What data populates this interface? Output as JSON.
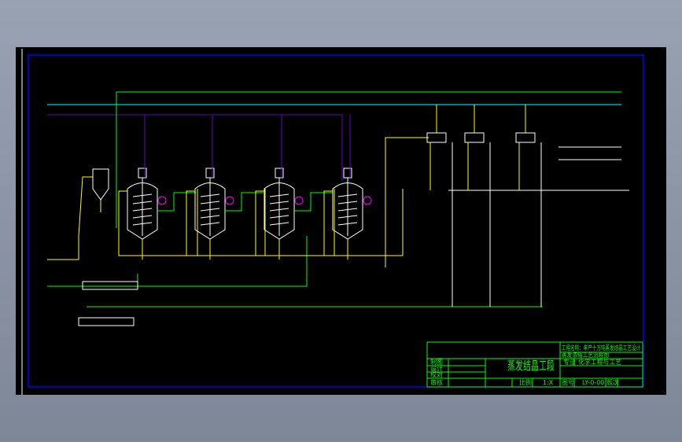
{
  "title_block": {
    "project_line1": "工程名称：年产十万吨蒸发结晶工艺设计",
    "project_line2": "蒸发浓缩工艺流程图",
    "drawing_title": "蒸发结晶工段",
    "major_label": "专业",
    "major_value": "化学工程与工艺",
    "rows": [
      "制图",
      "设计",
      "校对",
      "审核"
    ],
    "scale_label": "比例",
    "scale_value": "1:X",
    "number_label": "图号",
    "number_value": "LY-0-00",
    "version_label": "版次"
  },
  "colors": {
    "background": "#000000",
    "frame": "#0000ff",
    "steam": "#00ffff",
    "vacuum": "#6600cc",
    "water": "#00ff00",
    "material": "#ffff00",
    "labels": "#cc00ff",
    "valve": "#ff8800",
    "equipment": "#ffffff"
  }
}
